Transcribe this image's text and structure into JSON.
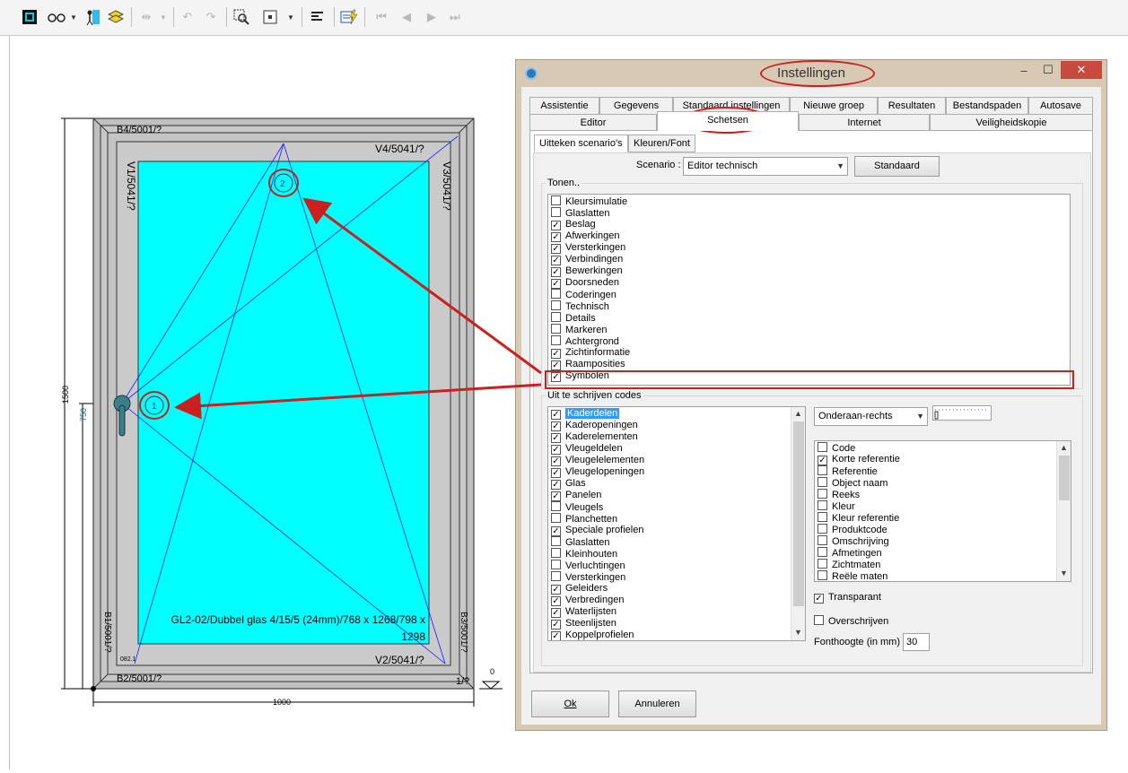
{
  "toolbar": {
    "buttons": [
      "frame-icon",
      "glasses-icon",
      "dropdown-arrow-icon",
      "person-icon",
      "layers-icon",
      "fit-width-icon",
      "undo-icon",
      "redo-icon",
      "zoom-select-icon",
      "view-box-icon",
      "align-left-icon",
      "lightning-icon",
      "first-icon",
      "prev-icon",
      "next-icon",
      "last-icon"
    ]
  },
  "drawing": {
    "top_sash_label": "V4/5041/?",
    "bottom_sash_label": "V2/5041/?",
    "left_sash_label": "V1/5041/?",
    "right_sash_label": "V3/5041/?",
    "frame_top_label": "B4/5001/?",
    "frame_bottom_label": "B2/5001/?",
    "frame_left_label": "B1/5001/?",
    "frame_right_label": "B3/5001/?",
    "glass_label_1": "GL2-02/Dubbel glas 4/15/5 (24mm)/768 x 1268/798 x",
    "glass_label_2": "1298",
    "corner_label": "1/?",
    "small_code": "082.1",
    "dim_height": "1500",
    "dim_half": "750",
    "dim_width": "1000",
    "level_mark": "0",
    "marker_1": "1",
    "marker_2": "2"
  },
  "dialog": {
    "title": "Instellingen",
    "minimize": "–",
    "maximize": "☐",
    "close": "✕",
    "tabs_row1": [
      "Assistentie",
      "Gegevens",
      "Standaard instellingen",
      "Nieuwe groep",
      "Resultaten",
      "Bestandspaden",
      "Autosave"
    ],
    "tabs_row2": [
      "Editor",
      "Schetsen",
      "Internet",
      "Veiligheidskopie"
    ],
    "subtabs": [
      "Uitteken scenario's",
      "Kleuren/Font"
    ],
    "scenario_label": "Scenario :",
    "scenario_value": "Editor technisch",
    "standaard_button": "Standaard",
    "tonen_title": "Tonen..",
    "tonen_items": [
      {
        "label": "Kleursimulatie",
        "checked": false
      },
      {
        "label": "Glaslatten",
        "checked": false
      },
      {
        "label": "Beslag",
        "checked": true
      },
      {
        "label": "Afwerkingen",
        "checked": true
      },
      {
        "label": "Versterkingen",
        "checked": true
      },
      {
        "label": "Verbindingen",
        "checked": true
      },
      {
        "label": "Bewerkingen",
        "checked": true
      },
      {
        "label": "Doorsneden",
        "checked": true
      },
      {
        "label": "Coderingen",
        "checked": false
      },
      {
        "label": "Technisch",
        "checked": false
      },
      {
        "label": "Details",
        "checked": false
      },
      {
        "label": "Markeren",
        "checked": false
      },
      {
        "label": "Achtergrond",
        "checked": false
      },
      {
        "label": "Zichtinformatie",
        "checked": true
      },
      {
        "label": "Raamposities",
        "checked": true
      },
      {
        "label": "Symbolen",
        "checked": true
      }
    ],
    "codes_title": "Uit te schrijven codes",
    "codes_items": [
      {
        "label": "Kaderdelen",
        "checked": true
      },
      {
        "label": "Kaderopeningen",
        "checked": true
      },
      {
        "label": "Kaderelementen",
        "checked": true
      },
      {
        "label": "Vleugeldelen",
        "checked": true
      },
      {
        "label": "Vleugelelementen",
        "checked": true
      },
      {
        "label": "Vleugelopeningen",
        "checked": true
      },
      {
        "label": "Glas",
        "checked": true
      },
      {
        "label": "Panelen",
        "checked": true
      },
      {
        "label": "Vleugels",
        "checked": false
      },
      {
        "label": "Planchetten",
        "checked": false
      },
      {
        "label": "Speciale profielen",
        "checked": true
      },
      {
        "label": "Glaslatten",
        "checked": false
      },
      {
        "label": "Kleinhouten",
        "checked": false
      },
      {
        "label": "Verluchtingen",
        "checked": false
      },
      {
        "label": "Versterkingen",
        "checked": false
      },
      {
        "label": "Geleiders",
        "checked": true
      },
      {
        "label": "Verbredingen",
        "checked": true
      },
      {
        "label": "Waterlijsten",
        "checked": true
      },
      {
        "label": "Steenlijsten",
        "checked": true
      },
      {
        "label": "Koppelprofielen",
        "checked": true
      }
    ],
    "position_value": "Onderaan-rechts",
    "ref_items": [
      {
        "label": "Code",
        "checked": false
      },
      {
        "label": "Korte referentie",
        "checked": true
      },
      {
        "label": "Referentie",
        "checked": false
      },
      {
        "label": "Object naam",
        "checked": false
      },
      {
        "label": "Reeks",
        "checked": false
      },
      {
        "label": "Kleur",
        "checked": false
      },
      {
        "label": "Kleur referentie",
        "checked": false
      },
      {
        "label": "Produktcode",
        "checked": false
      },
      {
        "label": "Omschrijving",
        "checked": false
      },
      {
        "label": "Afmetingen",
        "checked": false
      },
      {
        "label": "Zichtmaten",
        "checked": false
      },
      {
        "label": "Reële maten",
        "checked": false
      }
    ],
    "transparant_label": "Transparant",
    "transparant_checked": true,
    "overschrijven_label": "Overschrijven",
    "overschrijven_checked": false,
    "fonthoogte_label": "Fonthoogte (in mm) :",
    "fonthoogte_value": "30",
    "ok_button": "Ok",
    "annuleren_button": "Annuleren"
  },
  "colors": {
    "glass": "#00ffff",
    "annotation": "#cc1f1f",
    "frame": "#c0c0c0",
    "dialog_frame": "#d7c9b3"
  }
}
